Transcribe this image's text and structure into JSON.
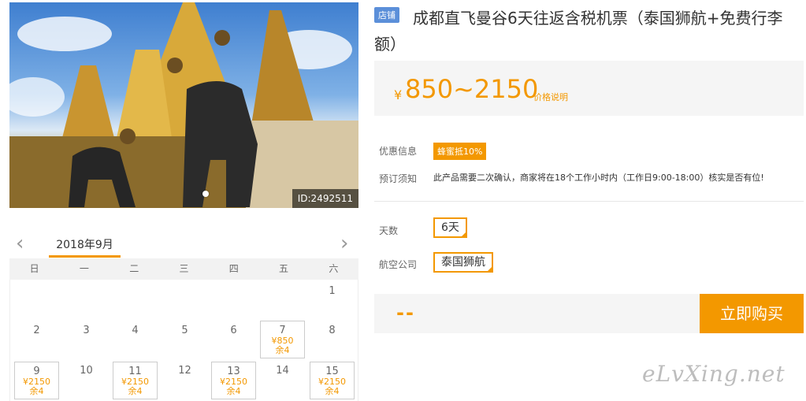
{
  "photo": {
    "id_label": "ID:2492511"
  },
  "calendar": {
    "month": "2018年9月",
    "weekdays": [
      "日",
      "一",
      "二",
      "三",
      "四",
      "五",
      "六"
    ],
    "d1": "1",
    "d2": "2",
    "d3": "3",
    "d4": "4",
    "d5": "5",
    "d6": "6",
    "d7": {
      "day": "7",
      "price": "¥850",
      "left": "余4"
    },
    "d8": "8",
    "d9": {
      "day": "9",
      "price": "¥2150",
      "left": "余4"
    },
    "d10": "10",
    "d11": {
      "day": "11",
      "price": "¥2150",
      "left": "余4"
    },
    "d12": "12",
    "d13": {
      "day": "13",
      "price": "¥2150",
      "left": "余4"
    },
    "d14": "14",
    "d15": {
      "day": "15",
      "price": "¥2150",
      "left": "余4"
    }
  },
  "product": {
    "shop_badge": "店铺",
    "title": "成都直飞曼谷6天往返含税机票（泰国狮航+免费行李额）",
    "price_yen": "¥",
    "price_range": "850~2150",
    "price_note": "价格说明",
    "promo_label": "优惠信息",
    "promo_badge": "蜂蜜抵10%",
    "notice_label": "预订须知",
    "notice_text": "此产品需要二次确认，商家将在18个工作小时内（工作日9:00-18:00）核实是否有位!",
    "days_label": "天数",
    "days_option": "6天",
    "airline_label": "航空公司",
    "airline_option": "泰国狮航",
    "total": "--",
    "buy_label": "立即购买"
  },
  "watermark": "eLvXing.net",
  "colors": {
    "accent": "#f39800",
    "badge_blue": "#5b8fd9"
  }
}
